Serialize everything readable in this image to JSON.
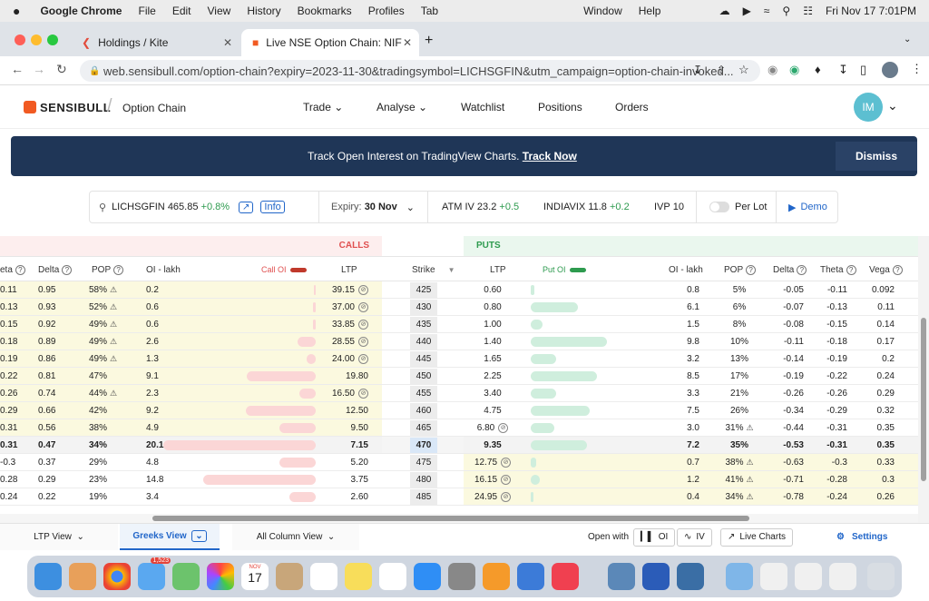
{
  "macos": {
    "app": "Google Chrome",
    "menus": [
      "File",
      "Edit",
      "View",
      "History",
      "Bookmarks",
      "Profiles",
      "Tab",
      "Window",
      "Help"
    ],
    "datetime": "Fri Nov 17  7:01PM"
  },
  "browser": {
    "tabs": [
      {
        "title": "Holdings / Kite"
      },
      {
        "title": "Live NSE Option Chain: NIFTY"
      }
    ],
    "url": "web.sensibull.com/option-chain?expiry=2023-11-30&tradingsymbol=LICHSGFIN&utm_campaign=option-chain-invoked..."
  },
  "nav": {
    "logo": "SENSIBULL",
    "page": "Option Chain",
    "items": [
      "Trade",
      "Analyse",
      "Watchlist",
      "Positions",
      "Orders"
    ],
    "avatar": "IM"
  },
  "banner": {
    "text": "Track Open Interest on TradingView Charts.",
    "link": "Track Now",
    "dismiss": "Dismiss"
  },
  "toolbar": {
    "symbol": "LICHSGFIN",
    "price": "465.85",
    "change": "+0.8%",
    "info": "Info",
    "expiry_label": "Expiry:",
    "expiry_value": "30 Nov",
    "atm_iv_label": "ATM IV",
    "atm_iv": "23.2",
    "atm_iv_change": "+0.5",
    "indiavix_label": "INDIAVIX",
    "indiavix": "11.8",
    "indiavix_change": "+0.2",
    "ivp_label": "IVP",
    "ivp": "10",
    "perlot": "Per Lot",
    "demo": "Demo"
  },
  "table": {
    "calls_label": "CALLS",
    "puts_label": "PUTS",
    "headers": {
      "theta": "eta",
      "delta": "Delta",
      "pop": "POP",
      "oi": "OI - lakh",
      "call_oi": "Call OI",
      "ltp": "LTP",
      "strike": "Strike",
      "put_ltp": "LTP",
      "put_oi": "Put OI",
      "put_oi_lakh": "OI - lakh",
      "put_pop": "POP",
      "put_delta": "Delta",
      "put_theta": "Theta",
      "vega": "Vega"
    },
    "rows": [
      {
        "c_theta": "0.11",
        "c_delta": "0.95",
        "c_pop": "58%",
        "c_pop_warn": true,
        "c_oi": "0.2",
        "c_oi_frac": 0.01,
        "c_ltp": "39.15",
        "c_ltp_icon": true,
        "strike": "425",
        "p_ltp": "0.60",
        "p_ltp_icon": false,
        "p_oi_frac": 0.05,
        "p_oi": "0.8",
        "p_pop": "5%",
        "p_pop_warn": false,
        "p_delta": "-0.05",
        "p_theta": "-0.11",
        "vega": "0.092",
        "itm": "call"
      },
      {
        "c_theta": "0.13",
        "c_delta": "0.93",
        "c_pop": "52%",
        "c_pop_warn": true,
        "c_oi": "0.6",
        "c_oi_frac": 0.02,
        "c_ltp": "37.00",
        "c_ltp_icon": true,
        "strike": "430",
        "p_ltp": "0.80",
        "p_ltp_icon": false,
        "p_oi_frac": 0.6,
        "p_oi": "6.1",
        "p_pop": "6%",
        "p_pop_warn": false,
        "p_delta": "-0.07",
        "p_theta": "-0.13",
        "vega": "0.11",
        "itm": "call"
      },
      {
        "c_theta": "0.15",
        "c_delta": "0.92",
        "c_pop": "49%",
        "c_pop_warn": true,
        "c_oi": "0.6",
        "c_oi_frac": 0.02,
        "c_ltp": "33.85",
        "c_ltp_icon": true,
        "strike": "435",
        "p_ltp": "1.00",
        "p_ltp_icon": false,
        "p_oi_frac": 0.15,
        "p_oi": "1.5",
        "p_pop": "8%",
        "p_pop_warn": false,
        "p_delta": "-0.08",
        "p_theta": "-0.15",
        "vega": "0.14",
        "itm": "call"
      },
      {
        "c_theta": "0.18",
        "c_delta": "0.89",
        "c_pop": "49%",
        "c_pop_warn": true,
        "c_oi": "2.6",
        "c_oi_frac": 0.12,
        "c_ltp": "28.55",
        "c_ltp_icon": true,
        "strike": "440",
        "p_ltp": "1.40",
        "p_ltp_icon": false,
        "p_oi_frac": 0.98,
        "p_oi": "9.8",
        "p_pop": "10%",
        "p_pop_warn": false,
        "p_delta": "-0.11",
        "p_theta": "-0.18",
        "vega": "0.17",
        "itm": "call"
      },
      {
        "c_theta": "0.19",
        "c_delta": "0.86",
        "c_pop": "49%",
        "c_pop_warn": true,
        "c_oi": "1.3",
        "c_oi_frac": 0.06,
        "c_ltp": "24.00",
        "c_ltp_icon": true,
        "strike": "445",
        "p_ltp": "1.65",
        "p_ltp_icon": false,
        "p_oi_frac": 0.32,
        "p_oi": "3.2",
        "p_pop": "13%",
        "p_pop_warn": false,
        "p_delta": "-0.14",
        "p_theta": "-0.19",
        "vega": "0.2",
        "itm": "call"
      },
      {
        "c_theta": "0.22",
        "c_delta": "0.81",
        "c_pop": "47%",
        "c_pop_warn": false,
        "c_oi": "9.1",
        "c_oi_frac": 0.45,
        "c_ltp": "19.80",
        "c_ltp_icon": false,
        "strike": "450",
        "p_ltp": "2.25",
        "p_ltp_icon": false,
        "p_oi_frac": 0.85,
        "p_oi": "8.5",
        "p_pop": "17%",
        "p_pop_warn": false,
        "p_delta": "-0.19",
        "p_theta": "-0.22",
        "vega": "0.24",
        "itm": "call"
      },
      {
        "c_theta": "0.26",
        "c_delta": "0.74",
        "c_pop": "44%",
        "c_pop_warn": true,
        "c_oi": "2.3",
        "c_oi_frac": 0.11,
        "c_ltp": "16.50",
        "c_ltp_icon": true,
        "strike": "455",
        "p_ltp": "3.40",
        "p_ltp_icon": false,
        "p_oi_frac": 0.33,
        "p_oi": "3.3",
        "p_pop": "21%",
        "p_pop_warn": false,
        "p_delta": "-0.26",
        "p_theta": "-0.26",
        "vega": "0.29",
        "itm": "call"
      },
      {
        "c_theta": "0.29",
        "c_delta": "0.66",
        "c_pop": "42%",
        "c_pop_warn": false,
        "c_oi": "9.2",
        "c_oi_frac": 0.46,
        "c_ltp": "12.50",
        "c_ltp_icon": false,
        "strike": "460",
        "p_ltp": "4.75",
        "p_ltp_icon": false,
        "p_oi_frac": 0.75,
        "p_oi": "7.5",
        "p_pop": "26%",
        "p_pop_warn": false,
        "p_delta": "-0.34",
        "p_theta": "-0.29",
        "vega": "0.32",
        "itm": "call"
      },
      {
        "c_theta": "0.31",
        "c_delta": "0.56",
        "c_pop": "38%",
        "c_pop_warn": false,
        "c_oi": "4.9",
        "c_oi_frac": 0.24,
        "c_ltp": "9.50",
        "c_ltp_icon": false,
        "strike": "465",
        "p_ltp": "6.80",
        "p_ltp_icon": true,
        "p_oi_frac": 0.3,
        "p_oi": "3.0",
        "p_pop": "31%",
        "p_pop_warn": true,
        "p_delta": "-0.44",
        "p_theta": "-0.31",
        "vega": "0.35",
        "itm": "call"
      },
      {
        "c_theta": "0.31",
        "c_delta": "0.47",
        "c_pop": "34%",
        "c_pop_warn": false,
        "c_oi": "20.1",
        "c_oi_frac": 1.0,
        "c_ltp": "7.15",
        "c_ltp_icon": false,
        "strike": "470",
        "p_ltp": "9.35",
        "p_ltp_icon": false,
        "p_oi_frac": 0.72,
        "p_oi": "7.2",
        "p_pop": "35%",
        "p_pop_warn": false,
        "p_delta": "-0.53",
        "p_theta": "-0.31",
        "vega": "0.35",
        "itm": "atm"
      },
      {
        "c_theta": "-0.3",
        "c_delta": "0.37",
        "c_pop": "29%",
        "c_pop_warn": false,
        "c_oi": "4.8",
        "c_oi_frac": 0.24,
        "c_ltp": "5.20",
        "c_ltp_icon": false,
        "strike": "475",
        "p_ltp": "12.75",
        "p_ltp_icon": true,
        "p_oi_frac": 0.07,
        "p_oi": "0.7",
        "p_pop": "38%",
        "p_pop_warn": true,
        "p_delta": "-0.63",
        "p_theta": "-0.3",
        "vega": "0.33",
        "itm": "put"
      },
      {
        "c_theta": "0.28",
        "c_delta": "0.29",
        "c_pop": "23%",
        "c_pop_warn": false,
        "c_oi": "14.8",
        "c_oi_frac": 0.74,
        "c_ltp": "3.75",
        "c_ltp_icon": false,
        "strike": "480",
        "p_ltp": "16.15",
        "p_ltp_icon": true,
        "p_oi_frac": 0.12,
        "p_oi": "1.2",
        "p_pop": "41%",
        "p_pop_warn": true,
        "p_delta": "-0.71",
        "p_theta": "-0.28",
        "vega": "0.3",
        "itm": "put"
      },
      {
        "c_theta": "0.24",
        "c_delta": "0.22",
        "c_pop": "19%",
        "c_pop_warn": false,
        "c_oi": "3.4",
        "c_oi_frac": 0.17,
        "c_ltp": "2.60",
        "c_ltp_icon": false,
        "strike": "485",
        "p_ltp": "24.95",
        "p_ltp_icon": true,
        "p_oi_frac": 0.04,
        "p_oi": "0.4",
        "p_pop": "34%",
        "p_pop_warn": true,
        "p_delta": "-0.78",
        "p_theta": "-0.24",
        "vega": "0.26",
        "itm": "put"
      }
    ]
  },
  "bottom": {
    "ltp_view": "LTP View",
    "greeks_view": "Greeks View",
    "all_column_view": "All Column View",
    "open_with": "Open with",
    "oi": "OI",
    "iv": "IV",
    "live_charts": "Live Charts",
    "settings": "Settings"
  },
  "dock": {
    "mail_badge": "1,523",
    "calendar_month": "NOV",
    "calendar_day": "17"
  },
  "colors": {
    "brand": "#f15a22",
    "calls": "#e05050",
    "puts": "#2e9b4f",
    "itm": "#fbf9df",
    "banner": "#1f3657",
    "link": "#2166c9"
  }
}
